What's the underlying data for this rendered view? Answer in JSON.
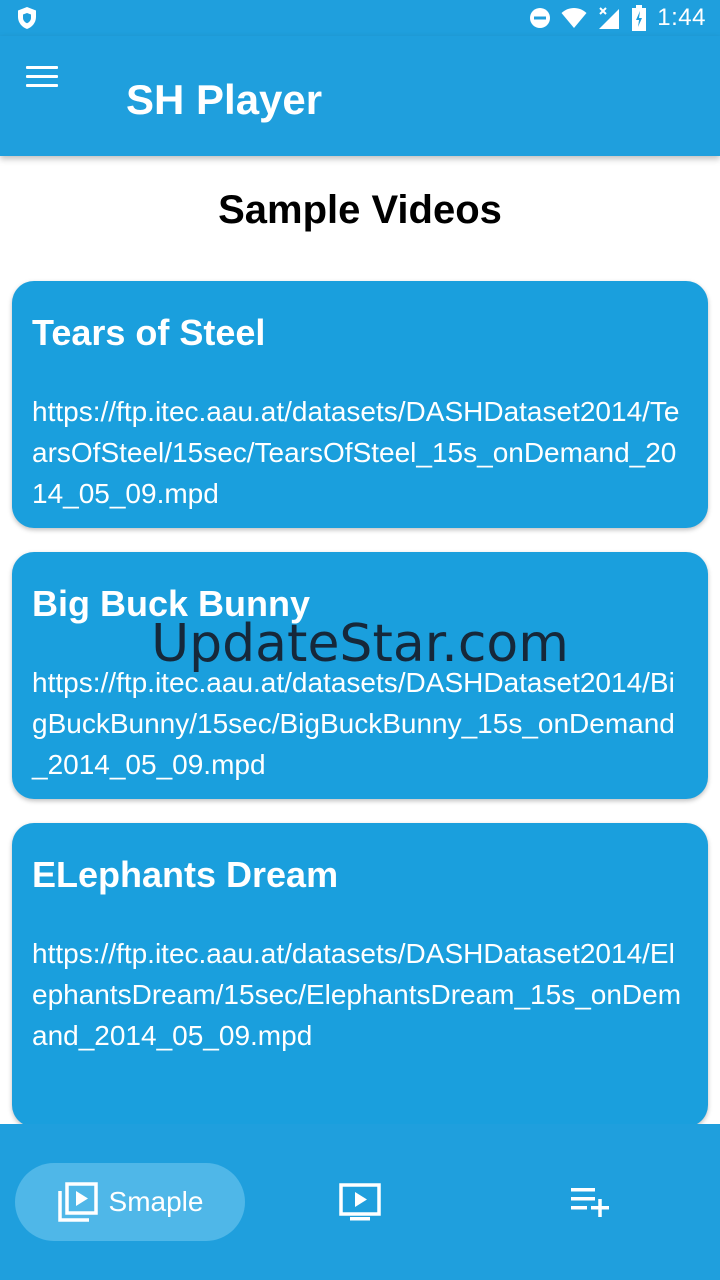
{
  "status_bar": {
    "time": "1:44"
  },
  "app_bar": {
    "title": "SH Player"
  },
  "section": {
    "title": "Sample Videos"
  },
  "videos": [
    {
      "title": "Tears of Steel",
      "url": "https://ftp.itec.aau.at/datasets/DASHDataset2014/TearsOfSteel/15sec/TearsOfSteel_15s_onDemand_2014_05_09.mpd"
    },
    {
      "title": "Big Buck Bunny",
      "url": "https://ftp.itec.aau.at/datasets/DASHDataset2014/BigBuckBunny/15sec/BigBuckBunny_15s_onDemand_2014_05_09.mpd"
    },
    {
      "title": "ELephants Dream",
      "url": "https://ftp.itec.aau.at/datasets/DASHDataset2014/ElephantsDream/15sec/ElephantsDream_15s_onDemand_2014_05_09.mpd"
    }
  ],
  "watermark": "UpdateStar.com",
  "bottom_nav": {
    "sample_label": "Smaple",
    "icons": [
      "video-library-icon",
      "play-video-icon",
      "playlist-add-icon"
    ]
  },
  "colors": {
    "primary": "#1f9fdd",
    "card": "#1a9fdd",
    "selected_nav": "#4fb7e8"
  }
}
